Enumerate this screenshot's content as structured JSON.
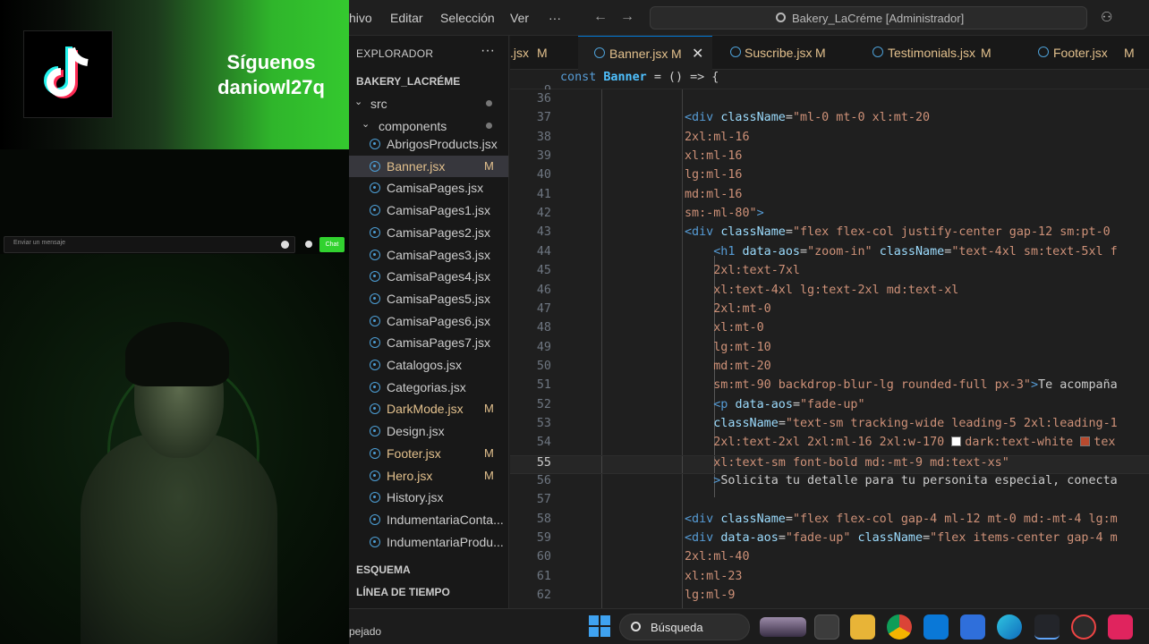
{
  "stream": {
    "banner_line1": "Síguenos",
    "banner_line2": "daniowl27q",
    "chat_placeholder": "Enviar un mensaje",
    "chat_button": "Chat"
  },
  "titlebar": {
    "menus": [
      "hivo",
      "Editar",
      "Selección",
      "Ver",
      "···"
    ],
    "search_text": "Bakery_LaCréme [Administrador]"
  },
  "explorer": {
    "header": "EXPLORADOR",
    "project": "BAKERY_LACRÉME",
    "folders": {
      "src": "src",
      "components": "components"
    },
    "files": [
      {
        "name": "AbrigosProducts.jsx",
        "badge": "",
        "modified": false
      },
      {
        "name": "Banner.jsx",
        "badge": "M",
        "modified": true
      },
      {
        "name": "CamisaPages.jsx",
        "badge": "",
        "modified": false
      },
      {
        "name": "CamisaPages1.jsx",
        "badge": "",
        "modified": false
      },
      {
        "name": "CamisaPages2.jsx",
        "badge": "",
        "modified": false
      },
      {
        "name": "CamisaPages3.jsx",
        "badge": "",
        "modified": false
      },
      {
        "name": "CamisaPages4.jsx",
        "badge": "",
        "modified": false
      },
      {
        "name": "CamisaPages5.jsx",
        "badge": "",
        "modified": false
      },
      {
        "name": "CamisaPages6.jsx",
        "badge": "",
        "modified": false
      },
      {
        "name": "CamisaPages7.jsx",
        "badge": "",
        "modified": false
      },
      {
        "name": "Catalogos.jsx",
        "badge": "",
        "modified": false
      },
      {
        "name": "Categorias.jsx",
        "badge": "",
        "modified": false
      },
      {
        "name": "DarkMode.jsx",
        "badge": "M",
        "modified": true
      },
      {
        "name": "Design.jsx",
        "badge": "",
        "modified": false
      },
      {
        "name": "Footer.jsx",
        "badge": "M",
        "modified": true
      },
      {
        "name": "Hero.jsx",
        "badge": "M",
        "modified": true
      },
      {
        "name": "History.jsx",
        "badge": "",
        "modified": false
      },
      {
        "name": "IndumentariaConta...",
        "badge": "",
        "modified": false
      },
      {
        "name": "IndumentariaProdu...",
        "badge": "",
        "modified": false
      }
    ],
    "sections": [
      "ESQUEMA",
      "LÍNEA DE TIEMPO"
    ]
  },
  "tabs": [
    {
      "name": ".jsx",
      "badge": "M",
      "active": false
    },
    {
      "name": "Banner.jsx",
      "badge": "M",
      "active": true
    },
    {
      "name": "Suscribe.jsx",
      "badge": "M",
      "active": false
    },
    {
      "name": "Testimonials.jsx",
      "badge": "M",
      "active": false
    },
    {
      "name": "Footer.jsx",
      "badge": "M",
      "active": false
    }
  ],
  "editor": {
    "sticky": {
      "num": "9",
      "text": "const Banner = () => {"
    },
    "current_line": "55",
    "lines": [
      {
        "num": "36",
        "html": ""
      },
      {
        "num": "37",
        "html": "<span class=\"tag\">&lt;div</span> <span class=\"attr\">className</span><span class=\"txt\">=</span><span class=\"str\">\"ml-0 mt-0 xl:mt-20</span>"
      },
      {
        "num": "38",
        "html": "<span class=\"str\">2xl:ml-16</span>"
      },
      {
        "num": "39",
        "html": "<span class=\"str\">xl:ml-16</span>"
      },
      {
        "num": "40",
        "html": "<span class=\"str\">lg:ml-16</span>"
      },
      {
        "num": "41",
        "html": "<span class=\"str\">md:ml-16</span>"
      },
      {
        "num": "42",
        "html": "<span class=\"str\">sm:-ml-80\"</span><span class=\"tag\">&gt;</span>"
      },
      {
        "num": "43",
        "html": "<span class=\"tag\">&lt;div</span> <span class=\"attr\">className</span><span class=\"txt\">=</span><span class=\"str\">\"flex flex-col justify-center gap-12 sm:pt-0</span>"
      },
      {
        "num": "44",
        "html": "    <span class=\"tag\">&lt;h1</span> <span class=\"attr\">data-aos</span><span class=\"txt\">=</span><span class=\"str\">\"zoom-in\"</span> <span class=\"attr\">className</span><span class=\"txt\">=</span><span class=\"str\">\"text-4xl sm:text-5xl f</span>"
      },
      {
        "num": "45",
        "html": "    <span class=\"str\">2xl:text-7xl</span>"
      },
      {
        "num": "46",
        "html": "    <span class=\"str\">xl:text-4xl lg:text-2xl md:text-xl</span>"
      },
      {
        "num": "47",
        "html": "    <span class=\"str\">2xl:mt-0</span>"
      },
      {
        "num": "48",
        "html": "    <span class=\"str\">xl:mt-0</span>"
      },
      {
        "num": "49",
        "html": "    <span class=\"str\">lg:mt-10</span>"
      },
      {
        "num": "50",
        "html": "    <span class=\"str\">md:mt-20</span>"
      },
      {
        "num": "51",
        "html": "    <span class=\"str\">sm:mt-90 backdrop-blur-lg rounded-full px-3\"</span><span class=\"tag\">&gt;</span><span class=\"txt\">Te acompaña</span>"
      },
      {
        "num": "52",
        "html": "    <span class=\"tag\">&lt;p</span> <span class=\"attr\">data-aos</span><span class=\"txt\">=</span><span class=\"str\">\"fade-up\"</span>"
      },
      {
        "num": "53",
        "html": "    <span class=\"attr\">className</span><span class=\"txt\">=</span><span class=\"str\">\"text-sm tracking-wide leading-5 2xl:leading-1</span>"
      },
      {
        "num": "54",
        "html": "    <span class=\"str\">2xl:text-2xl 2xl:ml-16 2xl:w-170 </span><span class=\"white-sq\"></span><span class=\"str\">dark:text-white </span><span class=\"red-sq\"></span><span class=\"str\">tex</span>"
      },
      {
        "num": "55",
        "html": "    <span class=\"str\">xl:text-sm font-bold md:-mt-9 md:text-xs\"</span>"
      },
      {
        "num": "56",
        "html": "    <span class=\"tag\">&gt;</span><span class=\"txt\">Solicita tu detalle para tu personita especial, conecta</span>"
      },
      {
        "num": "57",
        "html": ""
      },
      {
        "num": "58",
        "html": "<span class=\"tag\">&lt;div</span> <span class=\"attr\">className</span><span class=\"txt\">=</span><span class=\"str\">\"flex flex-col gap-4 ml-12 mt-0 md:-mt-4 lg:m</span>"
      },
      {
        "num": "59",
        "html": "<span class=\"tag\">&lt;div</span> <span class=\"attr\">data-aos</span><span class=\"txt\">=</span><span class=\"str\">\"fade-up\"</span> <span class=\"attr\">className</span><span class=\"txt\">=</span><span class=\"str\">\"flex items-center gap-4 m</span>"
      },
      {
        "num": "60",
        "html": "<span class=\"str\">2xl:ml-40</span>"
      },
      {
        "num": "61",
        "html": "<span class=\"str\">xl:ml-23</span>"
      },
      {
        "num": "62",
        "html": "<span class=\"str\">lg:ml-9</span>"
      }
    ]
  },
  "taskbar": {
    "status_text": "pejado",
    "search_label": "Búsqueda"
  },
  "colors": {
    "accent": "#0078d4",
    "modified": "#e2c08d",
    "stream_green": "#34c92f"
  }
}
